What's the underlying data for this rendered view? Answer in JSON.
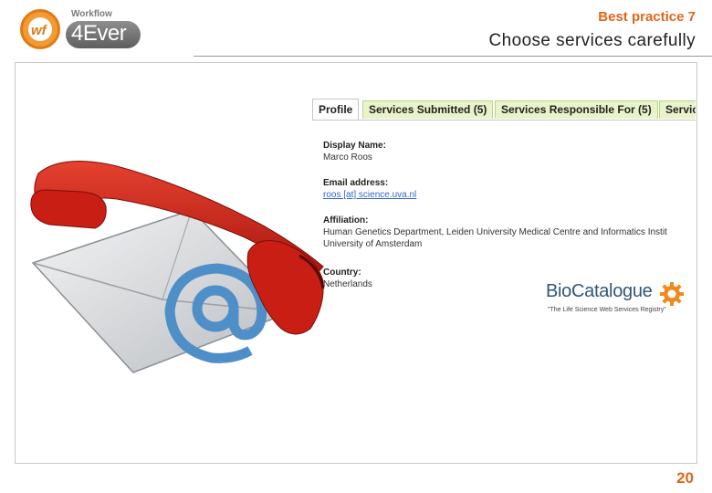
{
  "logo": {
    "mark": "wf",
    "top_text": "Workflow",
    "main_text": "4Ever"
  },
  "header": {
    "kicker": "Best practice 7",
    "title": "Choose services carefully"
  },
  "profile": {
    "tabs": [
      "Profile",
      "Services Submitted (5)",
      "Services Responsible For (5)",
      "Servic"
    ],
    "display_name_label": "Display Name:",
    "display_name": "Marco Roos",
    "email_label": "Email address:",
    "email": "roos [at] science.uva.nl",
    "affiliation_label": "Affiliation:",
    "affiliation_line1": "Human Genetics Department, Leiden University Medical Centre and Informatics Instit",
    "affiliation_line2": "University of Amsterdam",
    "country_label": "Country:",
    "country": "Netherlands"
  },
  "biocatalogue": {
    "name_part1": "Bio",
    "name_part2": "Catalogue",
    "tagline": "\"The Life Science Web Services Registry\""
  },
  "page_number": "20",
  "colors": {
    "accent": "#e0661a",
    "tab_fill": "#e9f3c9",
    "phone_red": "#cc2218",
    "at_blue": "#4f8fc8"
  }
}
